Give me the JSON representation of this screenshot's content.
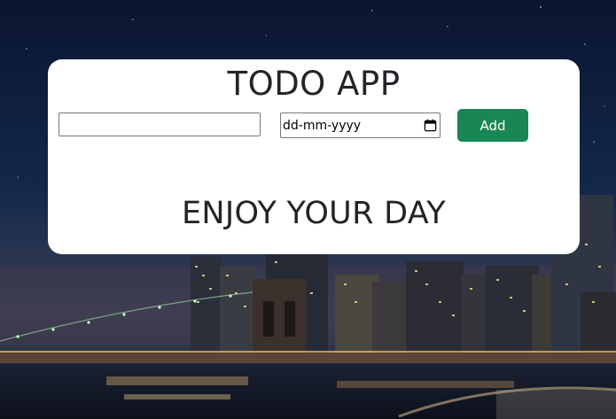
{
  "app": {
    "title": "TODO APP",
    "message": "ENJOY YOUR DAY"
  },
  "form": {
    "todo_input_value": "",
    "date_input_placeholder": "dd-mm-yyyy",
    "add_label": "Add"
  },
  "colors": {
    "accent": "#198754",
    "card": "#ffffff",
    "text": "#212529",
    "sky": "#0b1a33"
  },
  "icons": {
    "date_picker": "calendar-icon"
  }
}
